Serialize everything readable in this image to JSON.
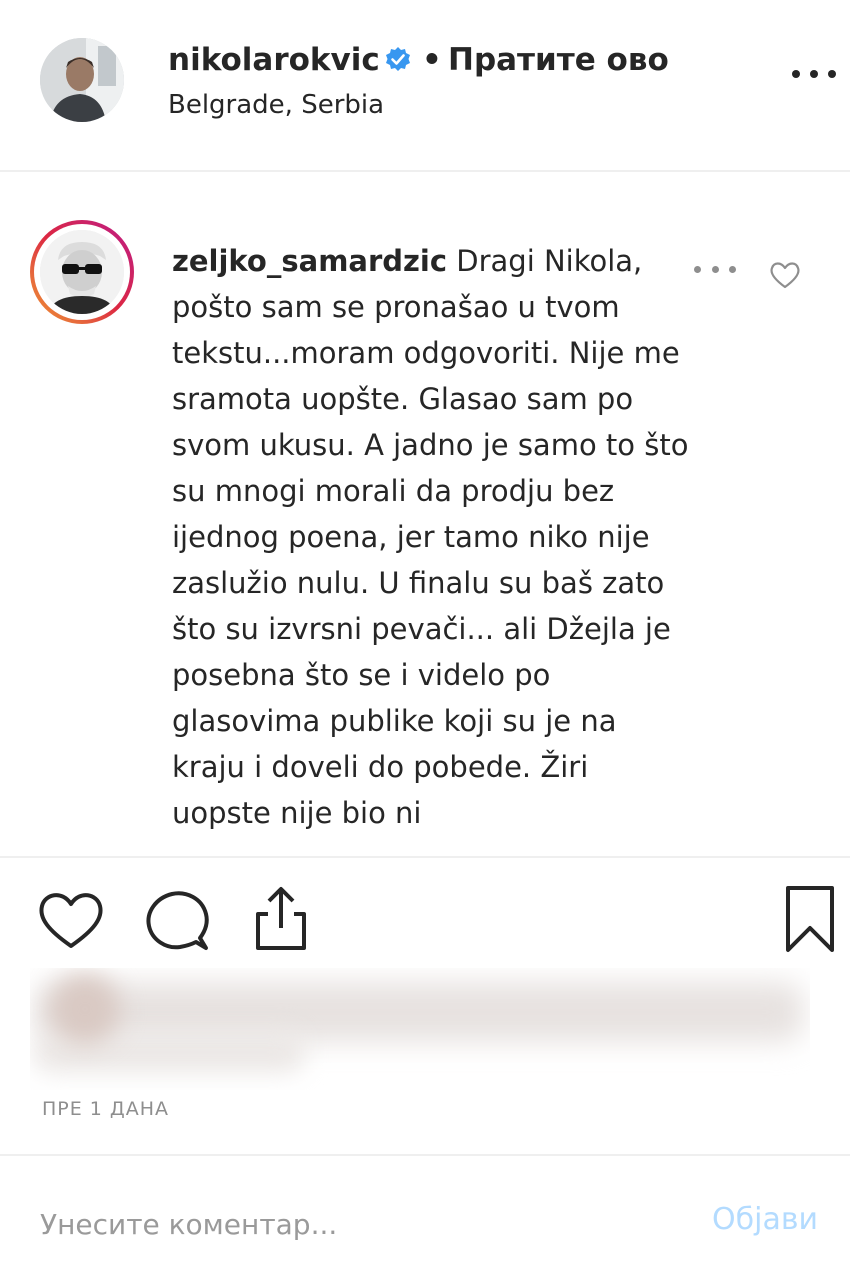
{
  "header": {
    "username": "nikolarokvic",
    "separator": "•",
    "follow_label": "Пратите ово",
    "location": "Belgrade, Serbia"
  },
  "comment": {
    "username": "zeljko_samardzic",
    "text": "Dragi Nikola, pošto sam se pronašao u tvom tekstu...moram odgovoriti. Nije me sramota uopšte. Glasao sam po svom ukusu. A jadno je samo to što su mnogi morali da prodju bez ijednog poena, jer tamo niko nije zaslužio nulu. U finalu su baš zato što su izvrsni pevači... ali Džejla je posebna što se i videlo po glasovima publike koji su je na kraju i doveli do pobede. Žiri uopste nije bio ni"
  },
  "post": {
    "timestamp": "ПРЕ 1 ДАНА"
  },
  "comment_box": {
    "placeholder": "Унесите коментар...",
    "post_label": "Објави"
  },
  "colors": {
    "verified": "#3897f0",
    "post_disabled": "#b3dbff",
    "text": "#262626",
    "muted": "#8e8e8e"
  },
  "icons": [
    "verified-badge-icon",
    "more-options-icon",
    "heart-icon",
    "comment-icon",
    "share-icon",
    "bookmark-icon"
  ]
}
